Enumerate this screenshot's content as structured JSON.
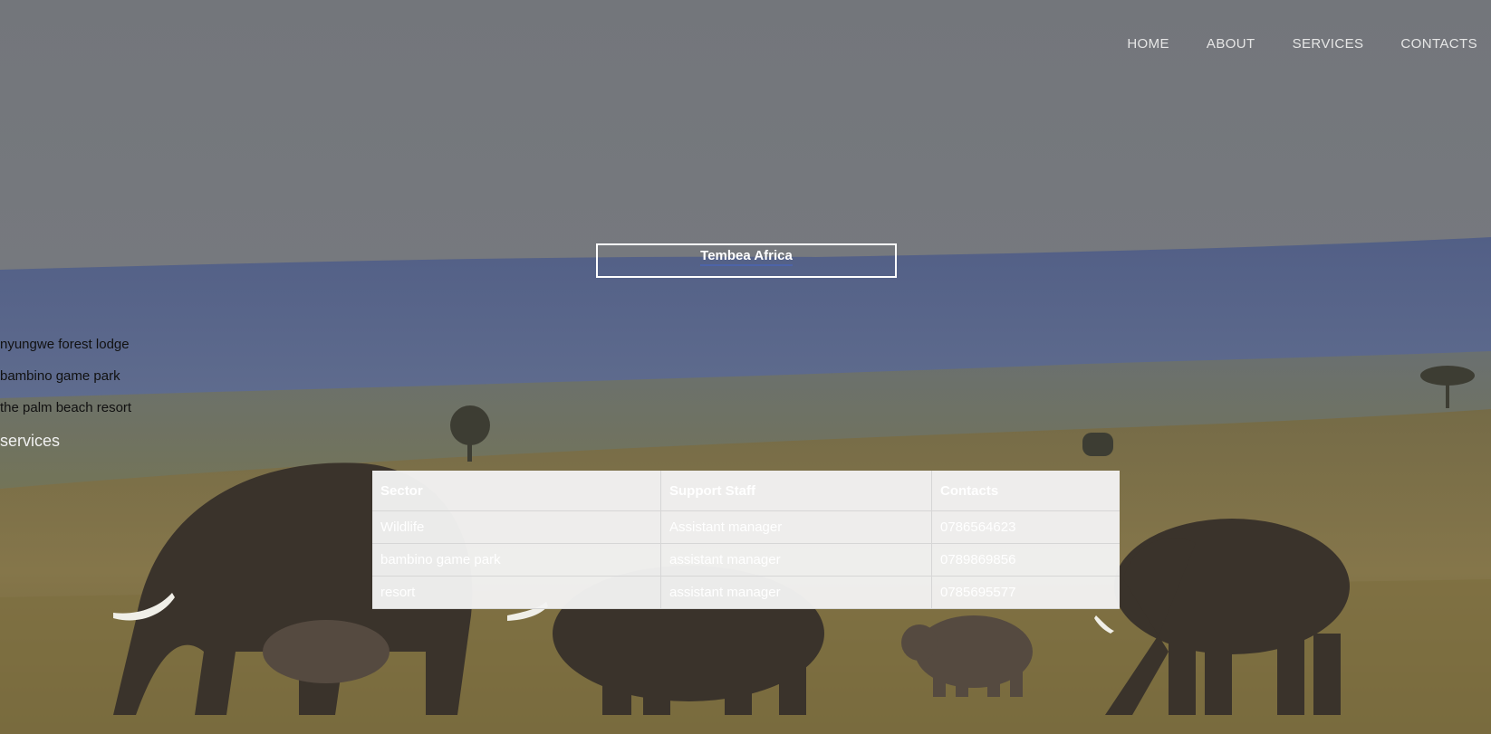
{
  "nav": {
    "items": [
      "HOME",
      "ABOUT",
      "SERVICES",
      "CONTACTS"
    ]
  },
  "brand": {
    "title": "Tembea Africa"
  },
  "side_links": [
    "nyungwe forest lodge",
    "bambino game park",
    "the palm beach resort"
  ],
  "services_heading": "services",
  "table": {
    "headers": [
      "Sector",
      "Support Staff",
      "Contacts"
    ],
    "rows": [
      [
        "Wildlife",
        "Assistant manager",
        "0786564623"
      ],
      [
        "bambino game park",
        "assistant manager",
        "0789869856"
      ],
      [
        "resort",
        "assistant manager",
        "0785695577"
      ]
    ]
  },
  "colors": {
    "sky": "#76797d",
    "hills": "#56658c",
    "grass": "#8a7a4a",
    "table_bg": "#f2f2f2"
  }
}
